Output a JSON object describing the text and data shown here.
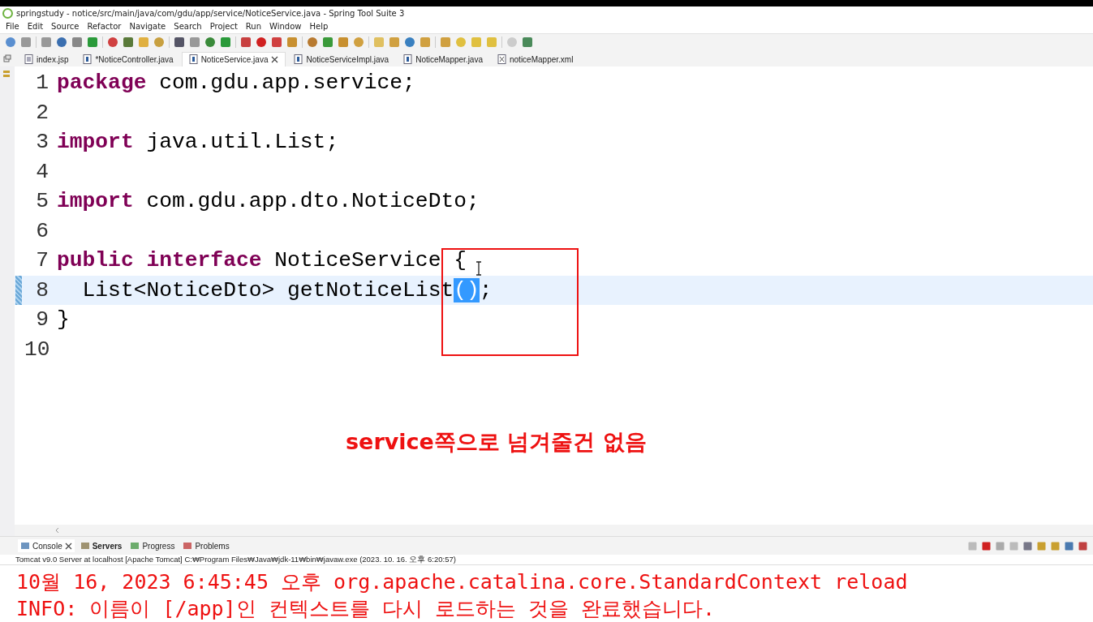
{
  "window": {
    "title": "springstudy - notice/src/main/java/com/gdu/app/service/NoticeService.java - Spring Tool Suite 3"
  },
  "menu": [
    "File",
    "Edit",
    "Source",
    "Refactor",
    "Navigate",
    "Search",
    "Project",
    "Run",
    "Window",
    "Help"
  ],
  "tabs": [
    {
      "label": "index.jsp",
      "kind": "jsp",
      "selected": false
    },
    {
      "label": "*NoticeController.java",
      "kind": "java",
      "selected": false
    },
    {
      "label": "NoticeService.java",
      "kind": "java",
      "selected": true
    },
    {
      "label": "NoticeServiceImpl.java",
      "kind": "java",
      "selected": false
    },
    {
      "label": "NoticeMapper.java",
      "kind": "java",
      "selected": false
    },
    {
      "label": "noticeMapper.xml",
      "kind": "xml",
      "selected": false
    }
  ],
  "code": [
    {
      "number": "1",
      "current": false,
      "tokens": [
        {
          "text": "package",
          "kind": "keyword"
        },
        {
          "text": " com.gdu.app.service;",
          "kind": "plain"
        }
      ]
    },
    {
      "number": "2",
      "current": false
    },
    {
      "number": "3",
      "current": false,
      "tokens": [
        {
          "text": "import",
          "kind": "keyword"
        },
        {
          "text": " java.util.List;",
          "kind": "plain"
        }
      ]
    },
    {
      "number": "4",
      "current": false
    },
    {
      "number": "5",
      "current": false,
      "tokens": [
        {
          "text": "import",
          "kind": "keyword"
        },
        {
          "text": " com.gdu.app.dto.NoticeDto;",
          "kind": "plain"
        }
      ]
    },
    {
      "number": "6",
      "current": false
    },
    {
      "number": "7",
      "current": false,
      "tokens": [
        {
          "text": "public interface",
          "kind": "keyword"
        },
        {
          "text": " NoticeService {",
          "kind": "plain"
        }
      ]
    },
    {
      "number": "8",
      "current": true,
      "tokens": [
        {
          "text": "  List<NoticeDto> getNoticeList",
          "kind": "plain"
        },
        {
          "text": "()",
          "kind": "selection"
        },
        {
          "text": ";",
          "kind": "plain"
        }
      ]
    },
    {
      "number": "9",
      "current": false,
      "tokens": [
        {
          "text": "}",
          "kind": "plain"
        }
      ]
    },
    {
      "number": "10",
      "current": false
    }
  ],
  "annotation": {
    "text": "service쪽으로 넘겨줄건 없음"
  },
  "console": {
    "tabs": [
      {
        "label": "Console",
        "selected": true,
        "updated": false
      },
      {
        "label": "Servers",
        "selected": false,
        "updated": true
      },
      {
        "label": "Progress",
        "selected": false,
        "updated": false
      },
      {
        "label": "Problems",
        "selected": false,
        "updated": false
      }
    ],
    "process": "Tomcat v9.0 Server at localhost [Apache Tomcat] C:₩Program Files₩Java₩jdk-11₩bin₩javaw.exe  (2023. 10. 16. 오후 6:20:57)",
    "lines": [
      "10월 16, 2023 6:45:45 오후 org.apache.catalina.core.StandardContext reload",
      "INFO: 이름이 [/app]인 컨텍스트를 다시 로드하는 것을 완료했습니다."
    ]
  }
}
